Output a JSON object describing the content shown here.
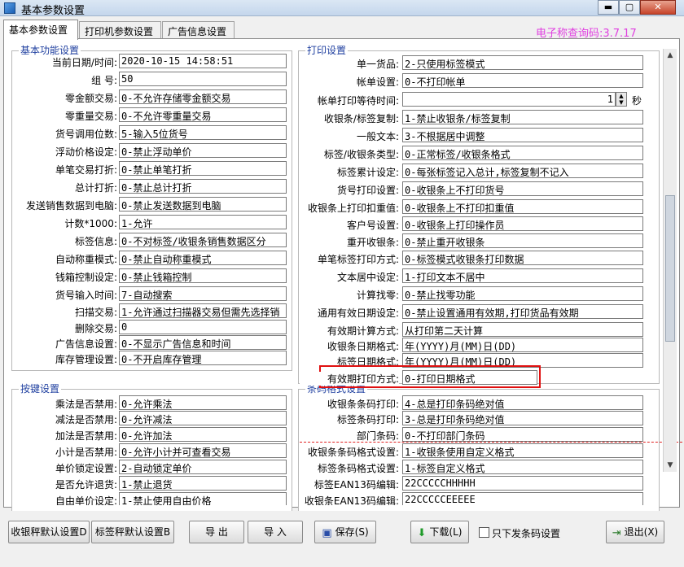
{
  "window": {
    "title": "基本参数设置",
    "minimize": "▬",
    "maximize": "▢",
    "close": "✕"
  },
  "tabs": [
    "基本参数设置",
    "打印机参数设置",
    "广告信息设置"
  ],
  "version": "电子称查询码:3.7.17",
  "basic": {
    "title": "基本功能设置",
    "rows": [
      {
        "label": "当前日期/时间:",
        "value": "2020-10-15 14:58:51"
      },
      {
        "label": "组        号:",
        "value": "50"
      },
      {
        "label": "零金额交易:",
        "value": "0-不允许存储零金额交易"
      },
      {
        "label": "零重量交易:",
        "value": "0-不允许零重量交易"
      },
      {
        "label": "货号调用位数:",
        "value": "5-输入5位货号"
      },
      {
        "label": "浮动价格设定:",
        "value": "0-禁止浮动单价"
      },
      {
        "label": "单笔交易打折:",
        "value": "0-禁止单笔打折"
      },
      {
        "label": "总计打折:",
        "value": "0-禁止总计打折"
      },
      {
        "label": "发送销售数据到电脑:",
        "value": "0-禁止发送数据到电脑"
      },
      {
        "label": "计数*1000:",
        "value": "1-允许"
      },
      {
        "label": "标签信息:",
        "value": "0-不对标签/收银条销售数据区分"
      },
      {
        "label": "自动称重模式:",
        "value": "0-禁止自动称重模式"
      },
      {
        "label": "钱箱控制设定:",
        "value": "0-禁止钱箱控制"
      },
      {
        "label": "货号输入时间:",
        "value": "7-自动搜索"
      },
      {
        "label": "扫描交易:",
        "value": "1-允许通过扫描器交易但需先选择销"
      },
      {
        "label": "删除交易:",
        "value": "0"
      },
      {
        "label": "广告信息设置:",
        "value": "0-不显示广告信息和时间"
      },
      {
        "label": "库存管理设置:",
        "value": "0-不开启库存管理"
      }
    ]
  },
  "keys": {
    "title": "按键设置",
    "rows": [
      {
        "label": "乘法是否禁用:",
        "value": "0-允许乘法"
      },
      {
        "label": "减法是否禁用:",
        "value": "0-允许减法"
      },
      {
        "label": "加法是否禁用:",
        "value": "0-允许加法"
      },
      {
        "label": "小计是否禁用:",
        "value": "0-允许小计并可查看交易"
      },
      {
        "label": "单价锁定设置:",
        "value": "2-自动锁定单价"
      },
      {
        "label": "是否允许退货:",
        "value": "1-禁止退货"
      },
      {
        "label": "自由单价设定:",
        "value": "1-禁止使用自由价格"
      }
    ]
  },
  "print": {
    "title": "打印设置",
    "seconds_unit": "秒",
    "spin_up": "▲",
    "spin_down": "▼",
    "rows": [
      {
        "label": "单一货品:",
        "value": "2-只使用标签模式"
      },
      {
        "label": "帐单设置:",
        "value": "0-不打印帐单"
      },
      {
        "label": "帐单打印等待时间:",
        "value": "1"
      },
      {
        "label": "收银条/标签复制:",
        "value": "1-禁止收银条/标签复制"
      },
      {
        "label": "一般文本:",
        "value": "3-不根据居中调整"
      },
      {
        "label": "标签/收银条类型:",
        "value": "0-正常标签/收银条格式"
      },
      {
        "label": "标签累计设定:",
        "value": "0-每张标签记入总计,标签复制不记入"
      },
      {
        "label": "货号打印设置:",
        "value": "0-收银条上不打印货号"
      },
      {
        "label": "收银条上打印扣重值:",
        "value": "0-收银条上不打印扣重值"
      },
      {
        "label": "客户号设置:",
        "value": "0-收银条上打印操作员"
      },
      {
        "label": "重开收银条:",
        "value": "0-禁止重开收银条"
      },
      {
        "label": "单笔标签打印方式:",
        "value": "0-标签模式收银条打印数据"
      },
      {
        "label": "文本居中设定:",
        "value": "1-打印文本不居中"
      },
      {
        "label": "计算找零:",
        "value": "0-禁止找零功能"
      },
      {
        "label": "通用有效日期设定:",
        "value": "0-禁止设置通用有效期,打印货品有效期"
      },
      {
        "label": "有效期计算方式:",
        "value": "从打印第二天计算"
      },
      {
        "label": "收银条日期格式:",
        "value": "年(YYYY)月(MM)日(DD)"
      },
      {
        "label": "标签日期格式:",
        "value": "年(YYYY)月(MM)日(DD)"
      },
      {
        "label": "有效期打印方式:",
        "value": "0-打印日期格式"
      }
    ]
  },
  "barcode": {
    "title": "条码格式设置",
    "rows": [
      {
        "label": "收银条条码打印:",
        "value": "4-总是打印条码绝对值"
      },
      {
        "label": "标签条码打印:",
        "value": "3-总是打印条码绝对值"
      },
      {
        "label": "部门条码:",
        "value": "0-不打印部门条码"
      },
      {
        "label": "收银条条码格式设置:",
        "value": "1-收银条使用自定义格式"
      },
      {
        "label": "标签条码格式设置:",
        "value": "1-标签自定义格式"
      },
      {
        "label": "标签EAN13码编辑:",
        "value": "22CCCCCHHHHH"
      },
      {
        "label": "收银条EAN13码编辑:",
        "value": "22CCCCCEEEEE"
      }
    ]
  },
  "buttons": {
    "cashier_default": "收银秤默认设置D",
    "label_default": "标签秤默认设置B",
    "export": "导  出",
    "import": "导  入",
    "save": "保存(S)",
    "download": "下载(L)",
    "only_barcode": "只下发条码设置",
    "exit": "退出(X)"
  }
}
